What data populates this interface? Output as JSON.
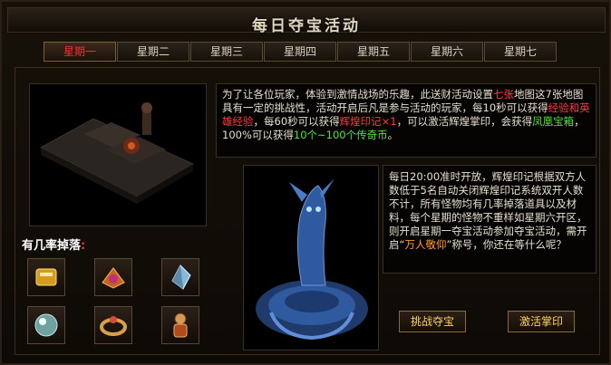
{
  "window": {
    "title": "每日夺宝活动"
  },
  "tabs": [
    {
      "label": "星期一",
      "active": true
    },
    {
      "label": "星期二",
      "active": false
    },
    {
      "label": "星期三",
      "active": false
    },
    {
      "label": "星期四",
      "active": false
    },
    {
      "label": "星期五",
      "active": false
    },
    {
      "label": "星期六",
      "active": false
    },
    {
      "label": "星期七",
      "active": false
    }
  ],
  "drops": {
    "label": "有几率掉落",
    "colon": ":",
    "items": [
      {
        "icon": "gold-ingot-icon"
      },
      {
        "icon": "winged-gem-icon"
      },
      {
        "icon": "crystal-icon"
      },
      {
        "icon": "orb-icon"
      },
      {
        "icon": "bracelet-icon"
      },
      {
        "icon": "doll-icon"
      }
    ]
  },
  "description": {
    "p1": "为了让各位玩家，体验到激情战场的乐趣，此送财活动设置",
    "p2": "七张",
    "p3": "地图这7张地图具有一定的挑战性，活动开启后凡是参与活动的玩家，每10秒可以获得",
    "p4": "经验和英雄经验",
    "p5": "，每60秒可以获得",
    "p6": "辉煌印记×1",
    "p7": "，可以激活辉煌掌印，会获得",
    "p8": "凤凰宝箱",
    "p9": "，100%可以获得",
    "p10": "10个~100个传奇币",
    "p11": "。"
  },
  "info": {
    "t1": "每日20:00准时开放，辉煌印记根据双方人数低于5名自动关闭辉煌印记系统双开人数不计，所有怪物均有几率掉落道具以及材料，每个星期的怪物不重样如星期六开区，则开启星期一夺宝活动参加夺宝活动，需开启“",
    "t2": "万人敬仰",
    "t3": "”称号，你还在等什么呢？"
  },
  "buttons": {
    "challenge": "挑战夺宝",
    "activate": "激活掌印"
  },
  "colors": {
    "accent_red": "#ff3b3b",
    "gold": "#ffd06a",
    "green": "#55e33a",
    "orange": "#ff9b2e"
  }
}
